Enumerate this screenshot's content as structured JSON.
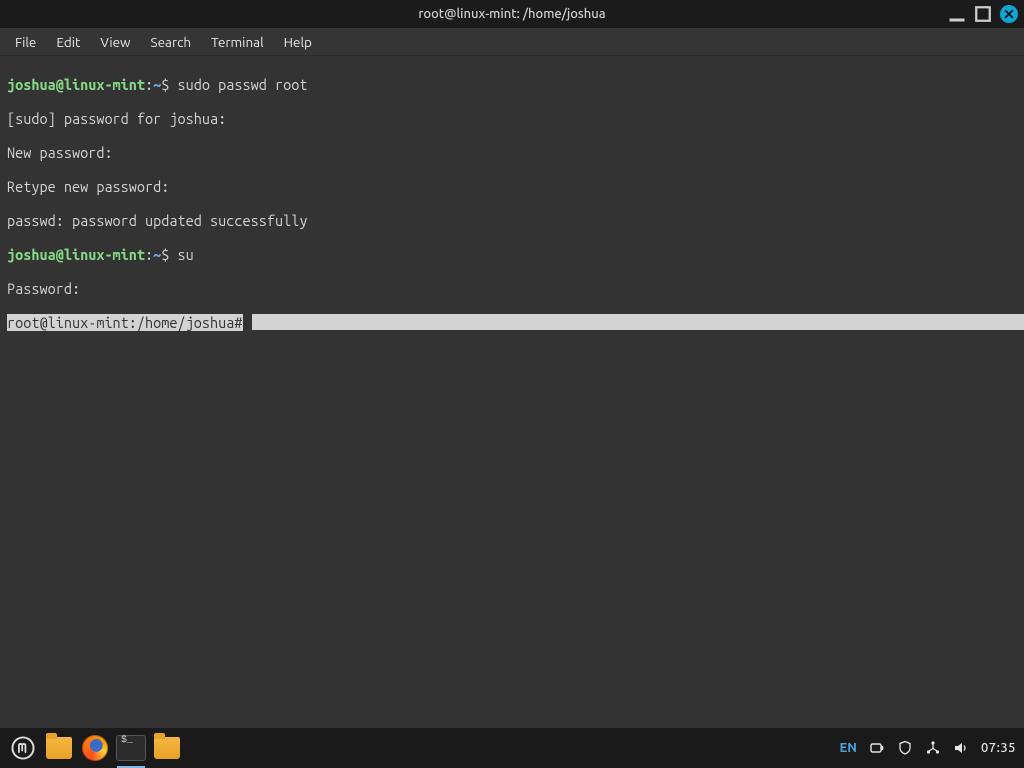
{
  "window": {
    "title": "root@linux-mint: /home/joshua"
  },
  "menu": {
    "items": [
      "File",
      "Edit",
      "View",
      "Search",
      "Terminal",
      "Help"
    ]
  },
  "terminal": {
    "prompt1_user": "joshua@linux-mint",
    "prompt1_sep": ":",
    "prompt1_path": "~",
    "prompt1_sym": "$ ",
    "cmd1": "sudo passwd root",
    "line2": "[sudo] password for joshua:",
    "line3": "New password:",
    "line4": "Retype new password:",
    "line5": "passwd: password updated successfully",
    "prompt2_user": "joshua@linux-mint",
    "prompt2_sep": ":",
    "prompt2_path": "~",
    "prompt2_sym": "$ ",
    "cmd2": "su",
    "line7": "Password:",
    "root_prompt_text": "root@linux-mint:/home/joshua#",
    "root_prompt_space": " ",
    "fill_pad": "                                                                                                             "
  },
  "taskbar": {
    "lang": "EN",
    "clock": "07:35"
  },
  "colors": {
    "bg": "#333333",
    "prompt_green": "#86d986",
    "prompt_blue": "#6fa8dc",
    "close_btn": "#0ea5d6"
  }
}
